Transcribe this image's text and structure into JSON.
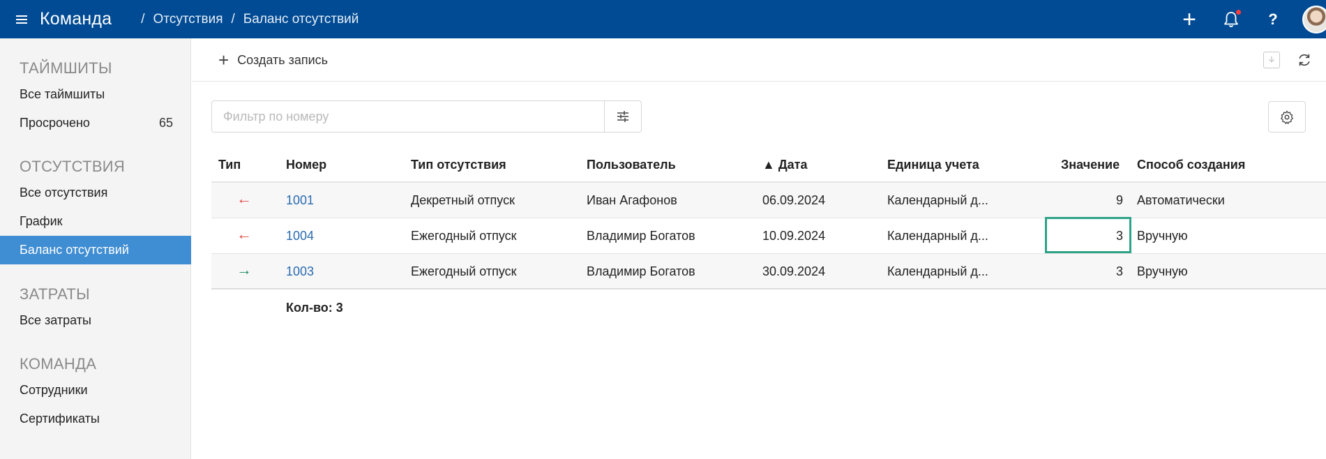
{
  "header": {
    "app_title": "Команда",
    "breadcrumb": [
      "Отсутствия",
      "Баланс отсутствий"
    ],
    "separator": "/",
    "help_label": "?"
  },
  "sidebar": {
    "sections": [
      {
        "title": "ТАЙМШИТЫ",
        "items": [
          {
            "label": "Все таймшиты"
          },
          {
            "label": "Просрочено",
            "count": "65"
          }
        ]
      },
      {
        "title": "ОТСУТСТВИЯ",
        "items": [
          {
            "label": "Все отсутствия"
          },
          {
            "label": "График"
          },
          {
            "label": "Баланс отсутствий",
            "active": true
          }
        ]
      },
      {
        "title": "ЗАТРАТЫ",
        "items": [
          {
            "label": "Все затраты"
          }
        ]
      },
      {
        "title": "КОМАНДА",
        "items": [
          {
            "label": "Сотрудники"
          },
          {
            "label": "Сертификаты"
          }
        ]
      }
    ]
  },
  "toolbar": {
    "create_label": "Создать запись"
  },
  "filter": {
    "placeholder": "Фильтр по номеру"
  },
  "table": {
    "columns": [
      "Тип",
      "Номер",
      "Тип отсутствия",
      "Пользователь",
      "▲ Дата",
      "Единица учета",
      "Значение",
      "Способ создания"
    ],
    "rows": [
      {
        "direction": "in",
        "direction_icon": "arrow-left-icon",
        "number": "1001",
        "absence_type": "Декретный отпуск",
        "user": "Иван Агафонов",
        "date": "06.09.2024",
        "unit": "Календарный д...",
        "value": "9",
        "creation": "Автоматически"
      },
      {
        "direction": "in",
        "direction_icon": "arrow-left-icon",
        "number": "1004",
        "absence_type": "Ежегодный отпуск",
        "user": "Владимир Богатов",
        "date": "10.09.2024",
        "unit": "Календарный д...",
        "value": "3",
        "creation": "Вручную"
      },
      {
        "direction": "out",
        "direction_icon": "arrow-right-icon",
        "number": "1003",
        "absence_type": "Ежегодный отпуск",
        "user": "Владимир Богатов",
        "date": "30.09.2024",
        "unit": "Календарный д...",
        "value": "3",
        "creation": "Вручную"
      }
    ],
    "count_label": "Кол-во: 3"
  },
  "colors": {
    "topbar": "#004b94",
    "active_item": "#3f8dd3",
    "link": "#2a6bb0",
    "incoming_arrow": "#e0473f",
    "outgoing_arrow": "#1e8a5e",
    "focus": "#2ea387",
    "notification_dot": "#ff3b3b"
  }
}
